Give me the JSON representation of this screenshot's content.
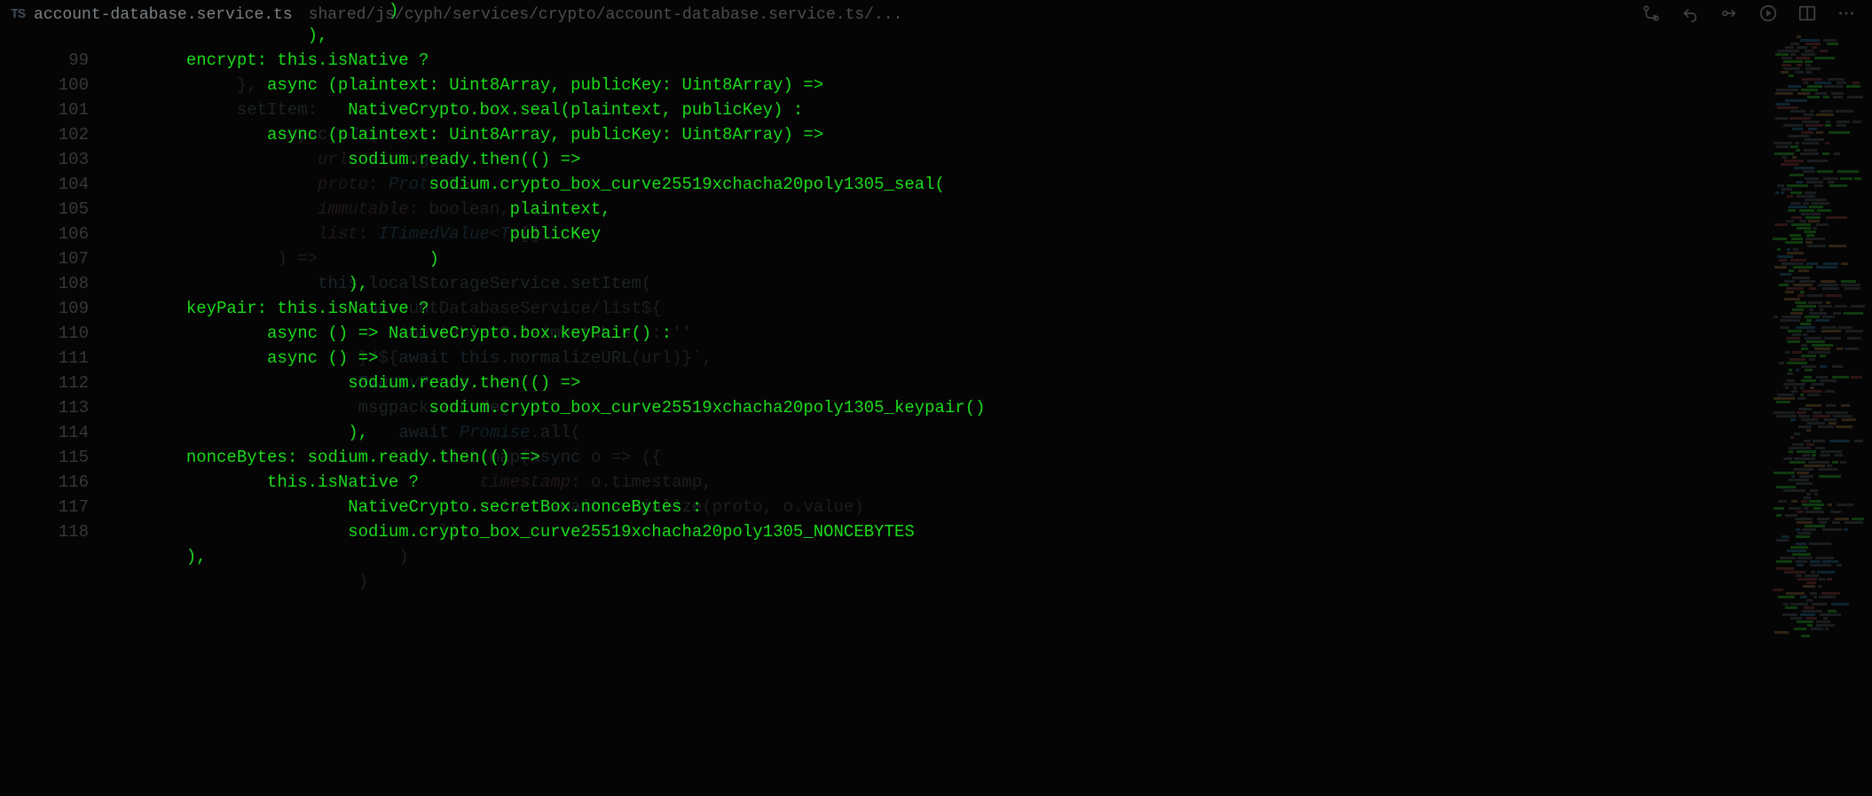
{
  "tab": {
    "lang_badge": "TS",
    "filename": "account-database.service.ts",
    "breadcrumb": "shared/js/cyph/services/crypto/account-database.service.ts/..."
  },
  "gutter": {
    "start": 99,
    "end": 118
  },
  "background_code": [
    "",
    "            },",
    "            setItem:",
    "                async <T>(",
    "                    url: string,",
    "                    proto: Proto<T>,",
    "                    immutable: boolean,",
    "                    list: ITimedValue<T>[]",
    "                ) =>",
    "                    this.localStorageService.setItem(",
    "                        `AccountDatabaseService/list${",
    "                            immutable ? '-immutable' : ''",
    "                        }/${await this.normalizeURL(url)}`,",
    "                        BinaryProto,",
    "                        msgpack.encode(",
    "                            await Promise.all(",
    "                                list.map(async o => ({",
    "                                    timestamp: o.timestamp,",
    "                                    value: await serialize(proto, o.value)",
    "                                }))",
    "                            )",
    "                        )"
  ],
  "foreground_code": [
    "                           )",
    "                   ),",
    "       encrypt: this.isNative ?",
    "               async (plaintext: Uint8Array, publicKey: Uint8Array) =>",
    "                       NativeCrypto.box.seal(plaintext, publicKey) :",
    "               async (plaintext: Uint8Array, publicKey: Uint8Array) =>",
    "                       sodium.ready.then(() =>",
    "                               sodium.crypto_box_curve25519xchacha20poly1305_seal(",
    "                                       plaintext,",
    "                                       publicKey",
    "                               )",
    "                       ),",
    "       keyPair: this.isNative ?",
    "               async () => NativeCrypto.box.keyPair() :",
    "               async () =>",
    "                       sodium.ready.then(() =>",
    "                               sodium.crypto_box_curve25519xchacha20poly1305_keypair()",
    "                       ),",
    "       nonceBytes: sodium.ready.then(() =>",
    "               this.isNative ?",
    "                       NativeCrypto.secretBox.nonceBytes :",
    "                       sodium.crypto_box_curve25519xchacha20poly1305_NONCEBYTES",
    "       ),"
  ],
  "minimap": {
    "colors": {
      "dim": "#1a1d1f",
      "green": "#0f3a0f",
      "blue": "#0e2430",
      "orange": "#2f2314",
      "red": "#2d1515"
    }
  }
}
